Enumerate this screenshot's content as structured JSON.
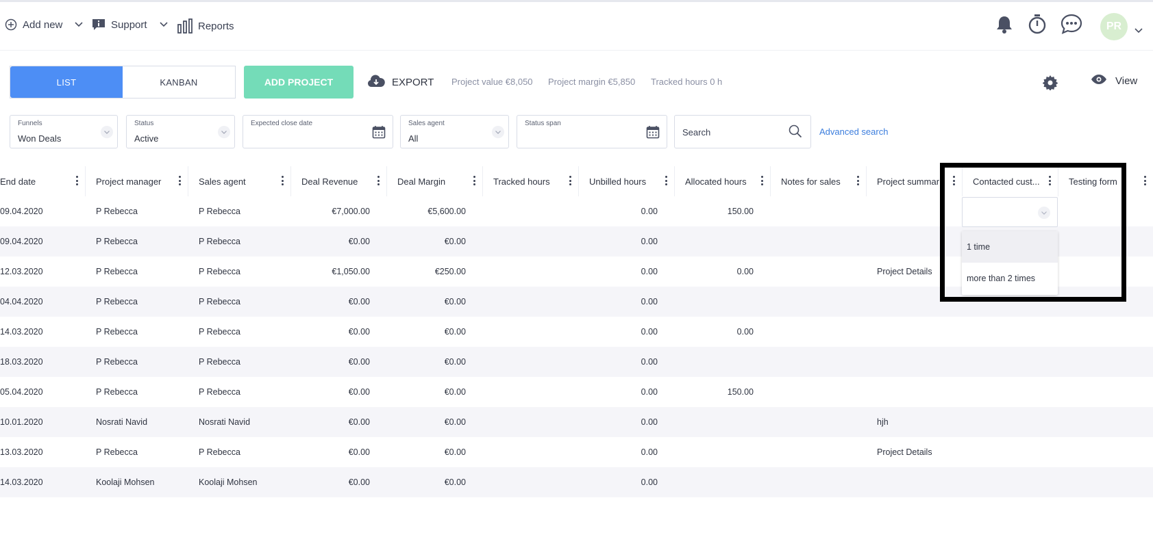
{
  "topbar": {
    "add_new": "Add new",
    "support": "Support",
    "reports": "Reports",
    "avatar_initials": "PR",
    "icons": [
      "plus-circle-icon",
      "info-icon",
      "bar-chart-icon",
      "bell-icon",
      "stopwatch-icon",
      "chat-icon",
      "chevron-down-icon"
    ]
  },
  "toolbar": {
    "list_label": "LIST",
    "kanban_label": "KANBAN",
    "add_project_label": "ADD PROJECT",
    "export_label": "EXPORT",
    "project_value": "Project value €8,050",
    "project_margin": "Project margin €5,850",
    "tracked_hours": "Tracked hours 0 h",
    "view_label": "View"
  },
  "filters": {
    "funnels": {
      "label": "Funnels",
      "value": "Won Deals"
    },
    "status": {
      "label": "Status",
      "value": "Active"
    },
    "expected_close_date": {
      "label": "Expected close date",
      "value": ""
    },
    "sales_agent": {
      "label": "Sales agent",
      "value": "All"
    },
    "status_span": {
      "label": "Status span",
      "value": ""
    },
    "search_placeholder": "Search",
    "advanced_search": "Advanced search"
  },
  "table": {
    "columns": [
      "End date",
      "Project manager",
      "Sales agent",
      "Deal Revenue",
      "Deal Margin",
      "Tracked hours",
      "Unbilled hours",
      "Allocated hours",
      "Notes for sales",
      "Project summar",
      "Contacted cust...",
      "Testing form"
    ],
    "rows": [
      [
        "09.04.2020",
        "P Rebecca",
        "P Rebecca",
        "€7,000.00",
        "€5,600.00",
        "",
        "0.00",
        "150.00",
        "",
        "",
        "",
        ""
      ],
      [
        "09.04.2020",
        "P Rebecca",
        "P Rebecca",
        "€0.00",
        "€0.00",
        "",
        "0.00",
        "",
        "",
        "",
        "",
        ""
      ],
      [
        "12.03.2020",
        "P Rebecca",
        "P Rebecca",
        "€1,050.00",
        "€250.00",
        "",
        "0.00",
        "0.00",
        "",
        "Project Details",
        "",
        ""
      ],
      [
        "04.04.2020",
        "P Rebecca",
        "P Rebecca",
        "€0.00",
        "€0.00",
        "",
        "0.00",
        "",
        "",
        "",
        "",
        ""
      ],
      [
        "14.03.2020",
        "P Rebecca",
        "P Rebecca",
        "€0.00",
        "€0.00",
        "",
        "0.00",
        "0.00",
        "",
        "",
        "",
        ""
      ],
      [
        "18.03.2020",
        "P Rebecca",
        "P Rebecca",
        "€0.00",
        "€0.00",
        "",
        "0.00",
        "",
        "",
        "",
        "",
        ""
      ],
      [
        "05.04.2020",
        "P Rebecca",
        "P Rebecca",
        "€0.00",
        "€0.00",
        "",
        "0.00",
        "150.00",
        "",
        "",
        "",
        ""
      ],
      [
        "10.01.2020",
        "Nosrati Navid",
        "Nosrati Navid",
        "€0.00",
        "€0.00",
        "",
        "0.00",
        "",
        "",
        "hjh",
        "",
        ""
      ],
      [
        "13.03.2020",
        "P Rebecca",
        "P Rebecca",
        "€0.00",
        "€0.00",
        "",
        "0.00",
        "",
        "",
        "Project Details",
        "",
        ""
      ],
      [
        "14.03.2020",
        "Koolaji Mohsen",
        "Koolaji Mohsen",
        "€0.00",
        "€0.00",
        "",
        "0.00",
        "",
        "",
        "",
        "",
        ""
      ]
    ]
  },
  "dropdown": {
    "selected": "",
    "options": [
      "1 time",
      "more than 2 times"
    ]
  },
  "colors": {
    "primary": "#4d8ef5",
    "add_project": "#74dcb8",
    "link": "#3b7ddd",
    "row_alt": "#f5f5f9",
    "avatar_bg": "#d8eed0"
  }
}
